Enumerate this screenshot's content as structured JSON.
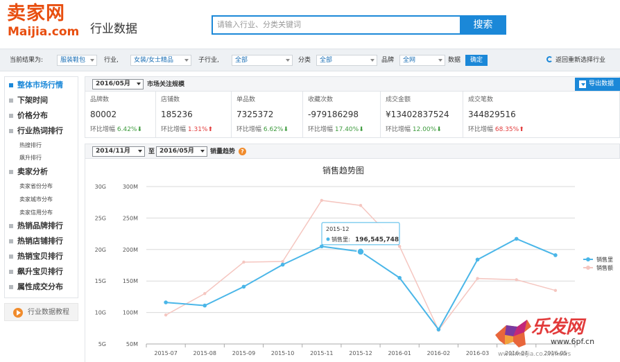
{
  "header": {
    "logo_cn": "卖家网",
    "logo_en": "Maijia.com",
    "page_title": "行业数据",
    "search_placeholder": "请输入行业、分类关键词",
    "search_button": "搜索"
  },
  "filter_bar": {
    "current_label": "当前结果为:",
    "industry_top": "服装鞋包",
    "industry_label": "行业,",
    "industry": "女装/女士精品",
    "sub_industry_label": "子行业,",
    "sub_industry": "全部",
    "category_label": "分类",
    "category": "全部",
    "brand_label": "品牌",
    "brand": "全网",
    "data_label": "数据",
    "confirm_button": "确定",
    "back_link": "返回重新选择行业"
  },
  "sidebar": {
    "items": [
      {
        "label": "整体市场行情",
        "active": true
      },
      {
        "label": "下架时间"
      },
      {
        "label": "价格分布"
      },
      {
        "label": "行业热词排行"
      },
      {
        "label": "热搜排行",
        "sub": true
      },
      {
        "label": "飙升排行",
        "sub": true
      },
      {
        "label": "卖家分析"
      },
      {
        "label": "卖家省份分布",
        "sub": true
      },
      {
        "label": "卖家城市分布",
        "sub": true
      },
      {
        "label": "卖家信用分布",
        "sub": true
      },
      {
        "label": "热销品牌排行"
      },
      {
        "label": "热销店铺排行"
      },
      {
        "label": "热销宝贝排行"
      },
      {
        "label": "飙升宝贝排行"
      },
      {
        "label": "属性成交分布"
      }
    ],
    "tutorial": "行业数据教程"
  },
  "market": {
    "month": "2016/05月",
    "title": "市场关注规模",
    "export_button": "导出数据",
    "change_prefix": "环比增幅",
    "stats": [
      {
        "label": "品牌数",
        "value": "80002",
        "change": "6.42%",
        "dir": "down"
      },
      {
        "label": "店铺数",
        "value": "185236",
        "change": "1.31%",
        "dir": "up"
      },
      {
        "label": "单品数",
        "value": "7325372",
        "change": "6.62%",
        "dir": "down"
      },
      {
        "label": "收藏次数",
        "value": "-979186298",
        "change": "17.40%",
        "dir": "down"
      },
      {
        "label": "成交金额",
        "value": "¥13402837524",
        "change": "12.00%",
        "dir": "down"
      },
      {
        "label": "成交笔数",
        "value": "344829516",
        "change": "68.35%",
        "dir": "up"
      }
    ]
  },
  "trend": {
    "from": "2014/11月",
    "to_label": "至",
    "to": "2016/05月",
    "title": "销量趋势",
    "help": "?"
  },
  "chart_data": {
    "type": "line",
    "title": "销售趋势图",
    "categories": [
      "2015-07",
      "2015-08",
      "2015-09",
      "2015-10",
      "2015-11",
      "2015-12",
      "2016-01",
      "2016-02",
      "2016-03",
      "2016-04",
      "2016-05"
    ],
    "left_axis_ticks": [
      "30G",
      "25G",
      "20G",
      "15G",
      "10G",
      "5G"
    ],
    "right_axis_ticks": [
      "300M",
      "250M",
      "200M",
      "150M",
      "100M",
      "50M"
    ],
    "ylim_volume": [
      50000000,
      300000000
    ],
    "ylim_amount": [
      5000000000,
      30000000000
    ],
    "series": [
      {
        "name": "销售里",
        "color": "#4ab6e8",
        "axis": "volume",
        "values": [
          116000000,
          111000000,
          141000000,
          176000000,
          205000000,
          196545748,
          155000000,
          73000000,
          184000000,
          217000000,
          191000000
        ]
      },
      {
        "name": "销售额",
        "color": "#f5c6c0",
        "axis": "amount",
        "values": [
          9600000000,
          13000000000,
          18000000000,
          18100000000,
          27800000000,
          27000000000,
          20500000000,
          7200000000,
          15400000000,
          15200000000,
          13500000000
        ]
      }
    ],
    "tooltip": {
      "category": "2015-12",
      "series": "销售里",
      "value": "196,545,748"
    },
    "legend": "right",
    "grid": true
  },
  "watermark": {
    "brand": "乐发网",
    "url1": "www.6pf.cn",
    "url2": "www.maijia.co...n/news"
  }
}
